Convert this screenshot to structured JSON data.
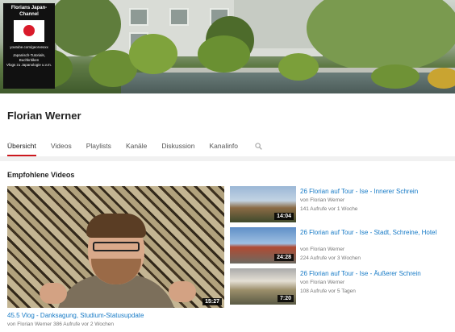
{
  "banner": {
    "badge_title": "Florians Japan-Channel",
    "badge_url": "youtube.com/georvexxx",
    "badge_desc_1": "Japanisch-Tutorials, Buchkritiken",
    "badge_desc_2": "Vlogs zu Japanologie u.v.m."
  },
  "channel": {
    "name": "Florian Werner"
  },
  "tabs": [
    {
      "label": "Übersicht",
      "active": true
    },
    {
      "label": "Videos"
    },
    {
      "label": "Playlists"
    },
    {
      "label": "Kanäle"
    },
    {
      "label": "Diskussion"
    },
    {
      "label": "Kanalinfo"
    }
  ],
  "section": {
    "title": "Empfohlene Videos"
  },
  "featured": {
    "duration": "15:27",
    "title": "45.5 Vlog - Danksagung, Studium-Statusupdate",
    "meta": "von Florian Werner   386 Aufrufe   vor 2 Wochen"
  },
  "videos": [
    {
      "title": "26 Florian auf Tour - Ise - Innerer Schrein",
      "author": "von Florian Werner",
      "stats": "141 Aufrufe   vor 1 Woche",
      "duration": "14:04"
    },
    {
      "title": "26 Florian auf Tour - Ise - Stadt, Schreine, Hotel",
      "author": "von Florian Werner",
      "stats": "224 Aufrufe   vor 3 Wochen",
      "duration": "24:28"
    },
    {
      "title": "26 Florian auf Tour - Ise - Äußerer Schrein",
      "author": "von Florian Werner",
      "stats": "108 Aufrufe   vor 5 Tagen",
      "duration": "7:20"
    }
  ],
  "colors": {
    "accent": "#cc181e",
    "link": "#167ac6"
  },
  "icons": {
    "search": "search-icon"
  }
}
